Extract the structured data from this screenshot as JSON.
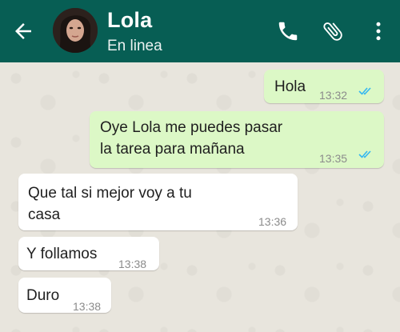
{
  "header": {
    "contact_name": "Lola",
    "status": "En linea"
  },
  "icons": {
    "back": "arrow-left-icon",
    "call": "phone-icon",
    "attach": "paperclip-icon",
    "menu": "more-vertical-icon"
  },
  "colors": {
    "header": "#075e54",
    "outgoing": "#dcf8c6",
    "incoming": "#ffffff",
    "read_ticks": "#34b7f1"
  },
  "messages": [
    {
      "direction": "out",
      "lines": [
        "Hola"
      ],
      "time": "13:32",
      "read": true
    },
    {
      "direction": "out",
      "lines": [
        "Oye Lola me puedes pasar",
        "la tarea para mañana"
      ],
      "time": "13:35",
      "read": true
    },
    {
      "direction": "in",
      "lines": [
        "Que tal si mejor voy a tu",
        "casa"
      ],
      "time": "13:36"
    },
    {
      "direction": "in",
      "lines": [
        "Y follamos"
      ],
      "time": "13:38"
    },
    {
      "direction": "in",
      "lines": [
        "Duro"
      ],
      "time": "13:38"
    }
  ]
}
